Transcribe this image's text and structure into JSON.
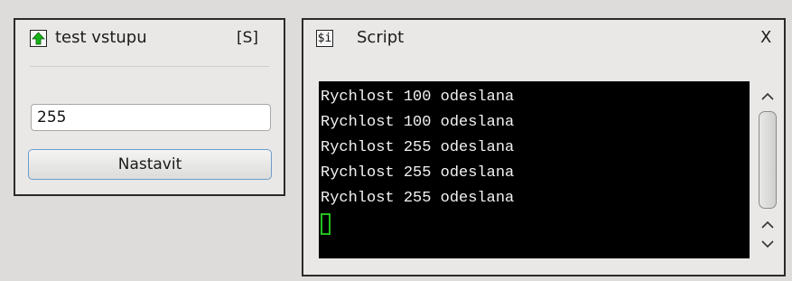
{
  "left_panel": {
    "title": "test vstupu",
    "tag": "[S]",
    "icon": "green-up-arrow-icon",
    "input_value": "255",
    "button_label": "Nastavit"
  },
  "right_panel": {
    "icon_label": "$i",
    "title": "Script",
    "close_label": "X",
    "console_lines": [
      "Rychlost 100 odeslana",
      "Rychlost 100 odeslana",
      "Rychlost 255 odeslana",
      "Rychlost 255 odeslana",
      "Rychlost 255 odeslana"
    ]
  },
  "colors": {
    "background": "#dddcda",
    "panel": "#e9e8e6",
    "console_bg": "#000000",
    "console_text": "#f2f2f2",
    "cursor": "#21c21c",
    "arrow_icon": "#19b319",
    "button_border": "#6d9ccc"
  }
}
